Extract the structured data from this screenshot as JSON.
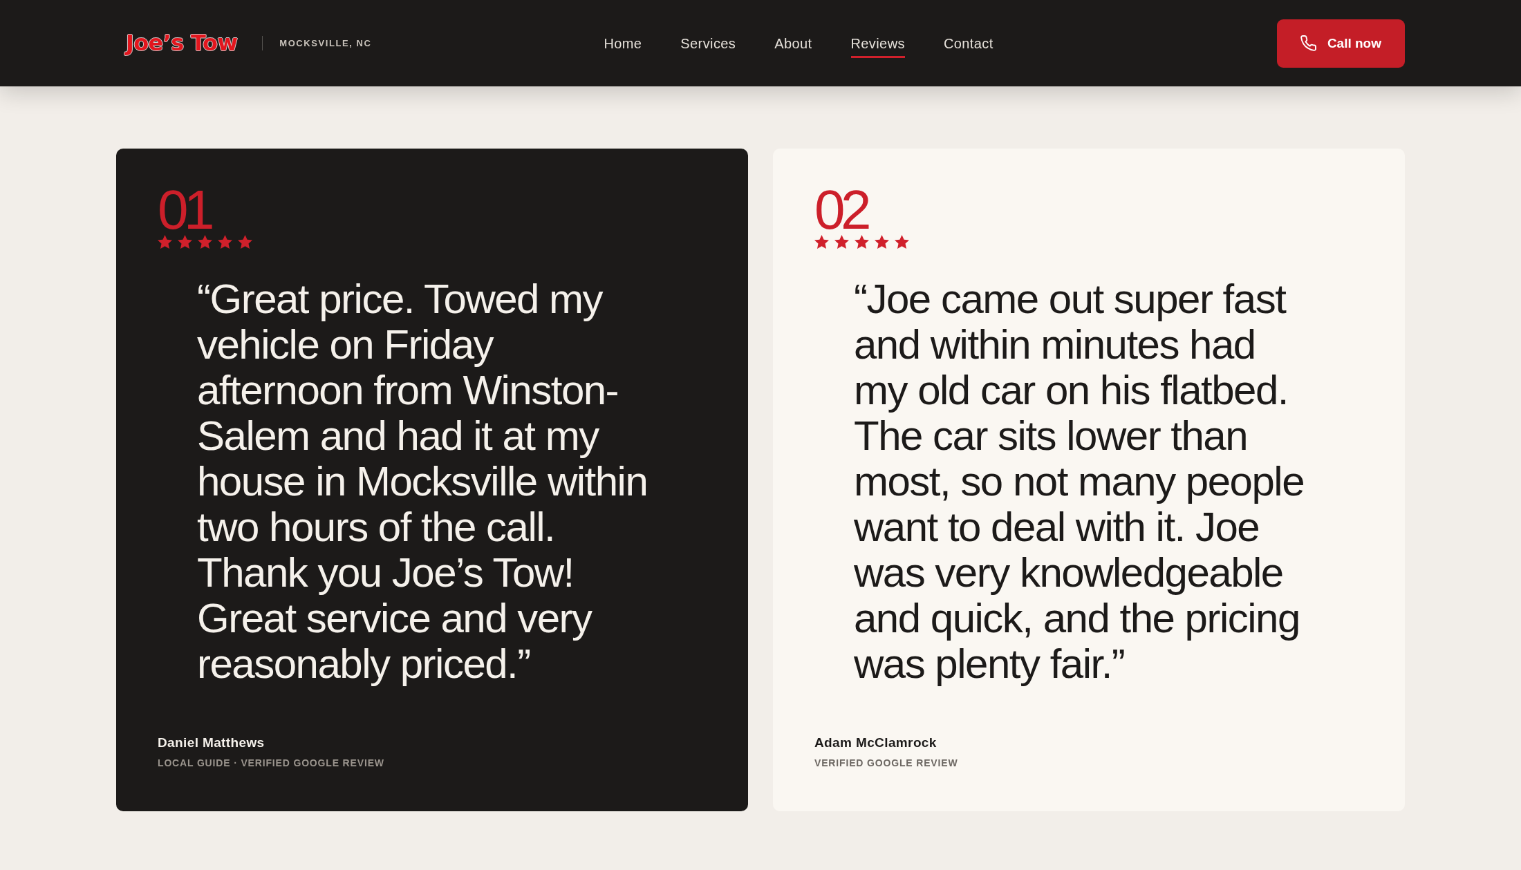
{
  "header": {
    "logo": "Joe’s Tow",
    "location": "MOCKSVILLE, NC",
    "nav": [
      {
        "label": "Home",
        "selected": false
      },
      {
        "label": "Services",
        "selected": false
      },
      {
        "label": "About",
        "selected": false
      },
      {
        "label": "Reviews",
        "selected": true
      },
      {
        "label": "Contact",
        "selected": false
      }
    ],
    "call_button": {
      "label": "Call now"
    }
  },
  "reviews": [
    {
      "number": "01",
      "stars": 5,
      "highlighted": true,
      "quote": "“Great price. Towed my vehicle on Friday afternoon from Winston-Salem and had it at my house in Mocksville within two hours of the call. Thank you Joe’s Tow! Great service and very reasonably priced.”",
      "name": "Daniel Matthews",
      "detail": "LOCAL GUIDE · VERIFIED GOOGLE REVIEW"
    },
    {
      "number": "02",
      "stars": 5,
      "highlighted": false,
      "quote": "“Joe came out super fast and within minutes had my old car on his flatbed. The car sits lower than most, so not many people want to deal with it. Joe was very knowledgeable and quick, and the pricing was plenty fair.”",
      "name": "Adam McClamrock",
      "detail": "VERIFIED GOOGLE REVIEW"
    }
  ]
}
